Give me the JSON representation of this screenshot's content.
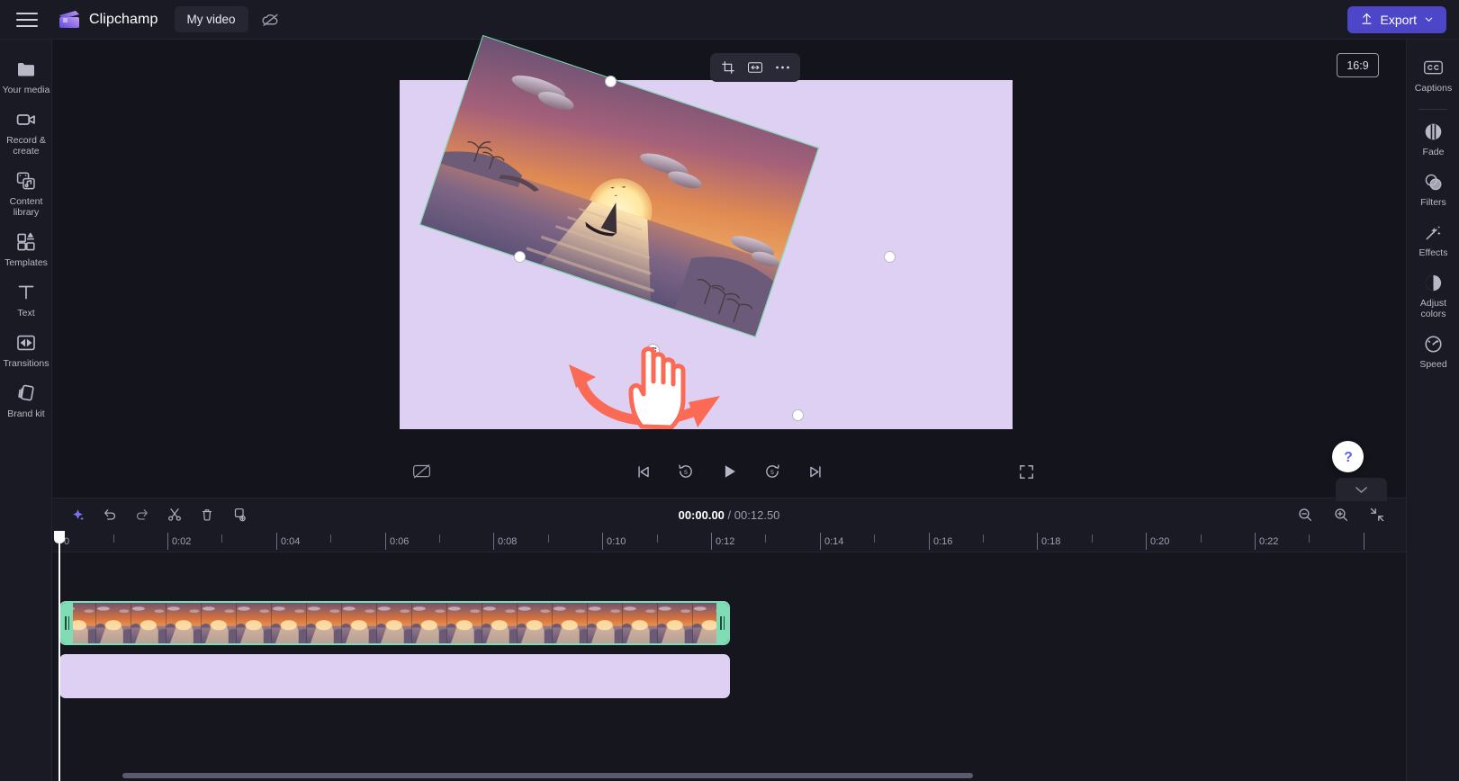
{
  "app": {
    "brand": "Clipchamp",
    "project_title": "My video",
    "menu_icon": "hamburger-icon",
    "cloud_icon": "cloud-off-icon"
  },
  "topbar": {
    "export_label": "Export",
    "export_icon": "upload-icon",
    "export_chevron": "chevron-down-icon",
    "export_color": "#4e46c9"
  },
  "left_sidebar": {
    "items": [
      {
        "label": "Your media",
        "icon": "folder-icon"
      },
      {
        "label": "Record & create",
        "icon": "video-camera-icon"
      },
      {
        "label": "Content library",
        "icon": "content-library-icon"
      },
      {
        "label": "Templates",
        "icon": "templates-icon"
      },
      {
        "label": "Text",
        "icon": "text-t-icon"
      },
      {
        "label": "Transitions",
        "icon": "transitions-icon"
      },
      {
        "label": "Brand kit",
        "icon": "brand-kit-icon"
      }
    ],
    "collapse_icon": "chevron-right-icon"
  },
  "right_sidebar": {
    "items": [
      {
        "label": "Captions",
        "icon": "cc-icon"
      },
      {
        "label": "Fade",
        "icon": "fade-icon"
      },
      {
        "label": "Filters",
        "icon": "filters-icon"
      },
      {
        "label": "Effects",
        "icon": "magic-wand-icon"
      },
      {
        "label": "Adjust colors",
        "icon": "contrast-circle-icon"
      },
      {
        "label": "Speed",
        "icon": "speedometer-icon"
      }
    ],
    "collapse_icon": "chevron-left-icon"
  },
  "preview": {
    "aspect_ratio": "16:9",
    "float_toolbar": [
      {
        "name": "crop-icon"
      },
      {
        "name": "fit-to-frame-icon"
      },
      {
        "name": "more-options-icon"
      }
    ],
    "canvas_background": "#ddd0f2",
    "selection_border_color": "#7fdcb5",
    "clip_rotation_degrees": 18.5,
    "gesture_hint": "rotate-clip-gesture",
    "annotation_color": "#fa6a55"
  },
  "transport": {
    "caption_toggle_icon": "captions-off-icon",
    "controls": [
      {
        "name": "skip-to-start-button",
        "icon": "skip-previous-icon"
      },
      {
        "name": "rewind-5s-button",
        "icon": "replay-5-icon",
        "value": "5"
      },
      {
        "name": "play-button",
        "icon": "play-icon"
      },
      {
        "name": "forward-5s-button",
        "icon": "forward-5-icon",
        "value": "5"
      },
      {
        "name": "skip-to-end-button",
        "icon": "skip-next-icon"
      }
    ],
    "fullscreen_icon": "fullscreen-icon",
    "help_icon": "question-mark-icon",
    "collapse_icon": "chevron-down-icon"
  },
  "timeline": {
    "toolbar_left": [
      {
        "name": "ai-suggest-button",
        "icon": "sparkle-icon"
      },
      {
        "name": "undo-button",
        "icon": "undo-arrow-icon"
      },
      {
        "name": "redo-button",
        "icon": "redo-arrow-icon"
      },
      {
        "name": "split-button",
        "icon": "scissors-icon"
      },
      {
        "name": "delete-button",
        "icon": "trash-icon"
      },
      {
        "name": "duplicate-button",
        "icon": "duplicate-icon"
      }
    ],
    "toolbar_right": [
      {
        "name": "zoom-out-button",
        "icon": "magnifier-minus-icon"
      },
      {
        "name": "zoom-in-button",
        "icon": "magnifier-plus-icon"
      },
      {
        "name": "fit-timeline-button",
        "icon": "fit-arrows-icon"
      }
    ],
    "current_time": "00:00.00",
    "time_separator": "/",
    "total_duration": "00:12.50",
    "ruler_labels": [
      "0",
      "0:02",
      "0:04",
      "0:06",
      "0:08",
      "0:10",
      "0:12",
      "0:14",
      "0:16",
      "0:18",
      "0:20",
      "0:22"
    ],
    "playhead_position_seconds": 0,
    "tracks": [
      {
        "name": "video-track",
        "clip_name": "sunset-sailboat-clip",
        "selected": true,
        "start_seconds": 0,
        "end_seconds": 12.5,
        "thumbnail_count": 19
      },
      {
        "name": "overlay-track",
        "clip_name": "lavender-background-clip",
        "selected": false,
        "start_seconds": 0,
        "end_seconds": 12.5
      }
    ]
  }
}
